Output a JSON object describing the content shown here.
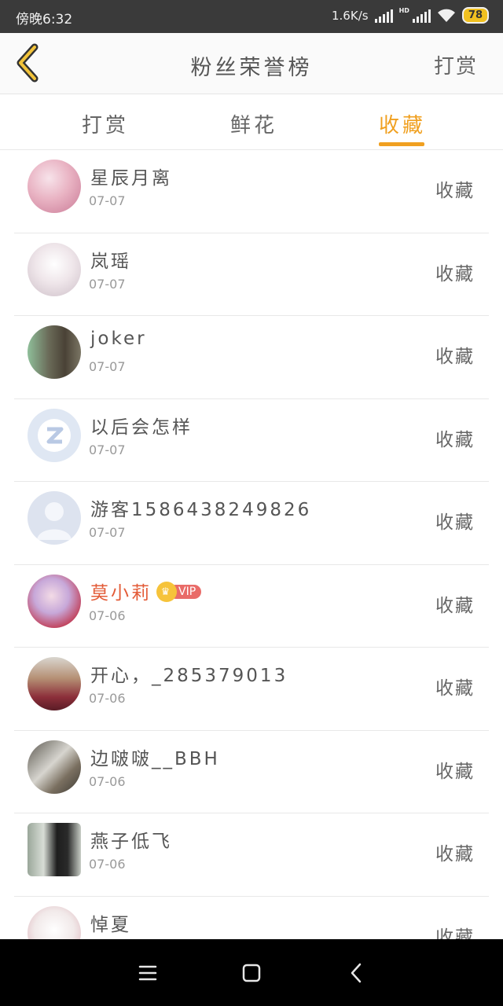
{
  "status_bar": {
    "time": "傍晚6:32",
    "net_speed": "1.6K/s",
    "hd_label": "HD",
    "battery": "78"
  },
  "header": {
    "title": "粉丝荣誉榜",
    "action_label": "打赏"
  },
  "tabs": [
    {
      "label": "打赏",
      "active": false
    },
    {
      "label": "鲜花",
      "active": false
    },
    {
      "label": "收藏",
      "active": true
    }
  ],
  "fans": [
    {
      "name": "星辰月离",
      "date": "07-07",
      "action": "收藏",
      "vip": false
    },
    {
      "name": "岚瑶",
      "date": "07-07",
      "action": "收藏",
      "vip": false
    },
    {
      "name": "joker",
      "date": "07-07",
      "action": "收藏",
      "vip": false
    },
    {
      "name": "以后会怎样",
      "date": "07-07",
      "action": "收藏",
      "vip": false
    },
    {
      "name": "游客1586438249826",
      "date": "07-07",
      "action": "收藏",
      "vip": false
    },
    {
      "name": "莫小莉",
      "date": "07-06",
      "action": "收藏",
      "vip": true,
      "vip_label": "VIP"
    },
    {
      "name": "开心，_285379013",
      "date": "07-06",
      "action": "收藏",
      "vip": false
    },
    {
      "name": "边啵啵__BBH",
      "date": "07-06",
      "action": "收藏",
      "vip": false
    },
    {
      "name": "燕子低飞",
      "date": "07-06",
      "action": "收藏",
      "vip": false
    },
    {
      "name": "悼夏",
      "date": "",
      "action": "收藏",
      "vip": false
    }
  ],
  "colors": {
    "accent": "#f0a020",
    "vip_name": "#e35b37",
    "status_bar": "#3a3a3a",
    "nav_bar": "#000000"
  }
}
